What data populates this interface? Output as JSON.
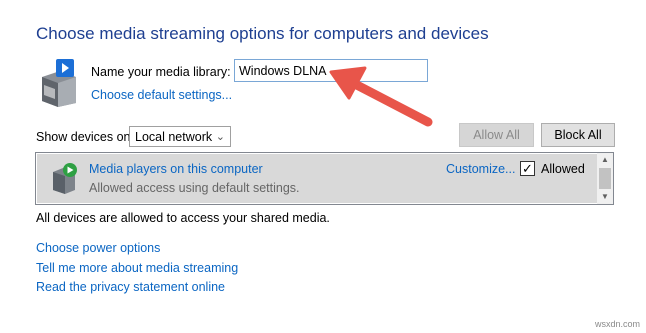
{
  "header": {
    "title": "Choose media streaming options for computers and devices"
  },
  "library": {
    "label": "Name your media library:",
    "value": "Windows DLNA",
    "default_settings_link": "Choose default settings..."
  },
  "devices": {
    "show_label": "Show devices on:",
    "network_selected": "Local network",
    "allow_all": "Allow All",
    "block_all": "Block All",
    "items": [
      {
        "name": "Media players on this computer",
        "description": "Allowed access using default settings.",
        "customize": "Customize...",
        "allowed_label": "Allowed",
        "allowed_checked": true
      }
    ],
    "status": "All devices are allowed to access your shared media."
  },
  "links": {
    "power": "Choose power options",
    "tell_more": "Tell me more about media streaming",
    "privacy": "Read the privacy statement online"
  },
  "watermark": "wsxdn.com",
  "colors": {
    "title": "#1e3f91",
    "link": "#0b66c3",
    "arrow": "#e8554a",
    "row_highlight": "#d9d9d9"
  },
  "icons": {
    "library": "media-library-server-icon",
    "device": "media-player-computer-icon",
    "dropdown": "chevron-down-icon"
  }
}
